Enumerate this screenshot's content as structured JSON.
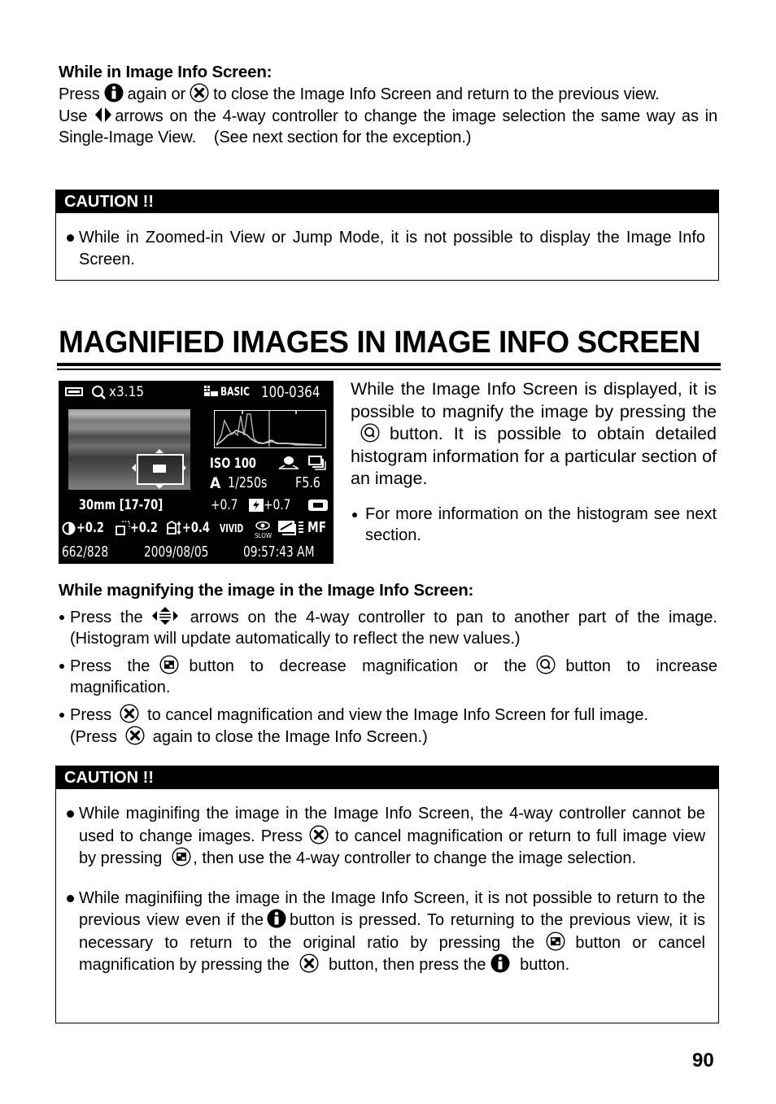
{
  "section1": {
    "heading": "While in Image Info Screen:",
    "p1_a": "Press",
    "p1_b": "again or",
    "p1_c": "to close the Image Info Screen and return to the previous view.",
    "p2_a": "Use",
    "p2_b": "arrows on the 4-way controller to change the image selection the same way as in Single-Image View.    (See next section for the exception.)"
  },
  "caution1": {
    "label": "CAUTION !!",
    "items": [
      "While in Zoomed-in View or Jump Mode, it is not possible to display the Image Info Screen."
    ]
  },
  "title": "MAGNIFIED IMAGES IN IMAGE INFO SCREEN",
  "camera_screen": {
    "zoom_readout": "x3.15",
    "quality": "BASIC",
    "file_number": "100-0364",
    "iso": "ISO 100",
    "mode": "A",
    "shutter": "1/250s",
    "aperture": "F5.6",
    "focal_length": "30mm [17-70]",
    "exposure_comp": "+0.7",
    "flash_comp": "+0.7",
    "contrast": "+0.2",
    "sharpness": "+0.2",
    "saturation": "+0.4",
    "color_mode": "VIVID",
    "flash_mode_sub": "SLOW",
    "focus_mode": "MF",
    "frame_count": "662/828",
    "date": "2009/08/05",
    "time": "09:57:43 AM"
  },
  "intro": {
    "p_a": "While the Image Info Screen is displayed, it is possible to magnify the image by pressing the",
    "p_b": "button. It is possible to obtain detailed histogram information for a particular section of an image.",
    "bullet": "For more information on the histogram see next section."
  },
  "section2": {
    "heading": "While magnifying the image in the Image Info Screen:",
    "b1_a": "Press the",
    "b1_b": "arrows on the 4-way controller to pan to another part of the image. (Histogram will update automatically to reflect the new values.)",
    "b2_a": "Press the",
    "b2_b": "button to decrease magnification or the",
    "b2_c": "button to increase magnification.",
    "b3_a": "Press",
    "b3_b": "to cancel magnification and view the Image Info Screen for full image.",
    "b3_c": "(Press",
    "b3_d": "again to close the Image Info Screen.)"
  },
  "caution2": {
    "label": "CAUTION !!",
    "i1_a": "While maginifing the image in the Image Info Screen, the 4-way controller cannot be used to change images. Press",
    "i1_b": "to cancel magnification or return to full image view by pressing",
    "i1_c": ", then use the 4-way controller to change the image selection.",
    "i2_a": "While maginifiing the image in the Image Info Screen, it is not possible to return to the previous view even if the",
    "i2_b": "button is pressed. To returning to the previous view, it is necessary to return to the original ratio by pressing the",
    "i2_c": "button or cancel magnification by pressing the",
    "i2_d": "button, then press the",
    "i2_e": "button."
  },
  "page_number": "90"
}
